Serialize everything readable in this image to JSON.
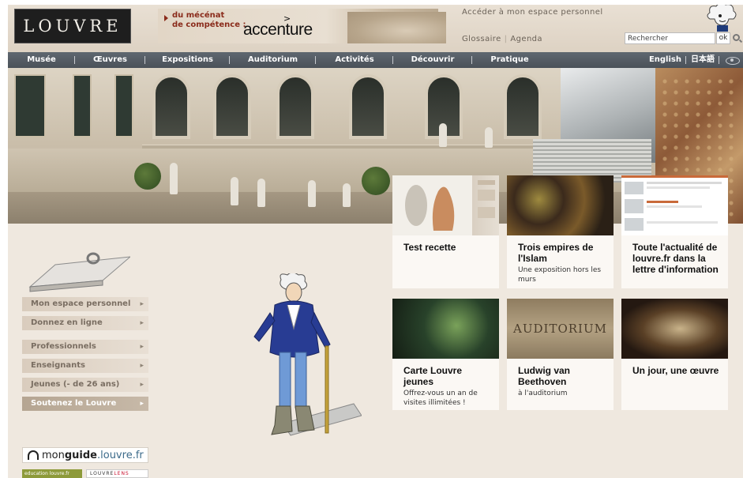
{
  "header": {
    "logo_text": "LOUVRE",
    "sponsor_line1": "du mécénat",
    "sponsor_line2": "de compétence :",
    "sponsor_name": "accenture",
    "espace_link": "Accéder à mon espace personnel",
    "glossaire": "Glossaire",
    "agenda": "Agenda",
    "search_placeholder": "Rechercher",
    "search_button": "ok"
  },
  "nav": {
    "items": [
      "Musée",
      "Œuvres",
      "Expositions",
      "Auditorium",
      "Activités",
      "Découvrir",
      "Pratique"
    ],
    "lang_en": "English",
    "lang_jp": "日本語"
  },
  "sidebar": {
    "menu": [
      {
        "label": "Mon espace personnel"
      },
      {
        "label": "Donnez en ligne"
      },
      {
        "label": "Professionnels"
      },
      {
        "label": "Enseignants"
      },
      {
        "label": "Jeunes (- de 26 ans)"
      },
      {
        "label": "Soutenez le Louvre"
      }
    ],
    "chevron": "▸",
    "monguide_pre": "mon",
    "monguide_bold": "guide",
    "monguide_domain": ".louvre.fr",
    "education_text": "education louvre.fr",
    "lens_pre": "LOUVRE",
    "lens_red": "LENS"
  },
  "cards": [
    {
      "title": "Test recette",
      "subtitle": ""
    },
    {
      "title": "Trois empires de l'Islam",
      "subtitle": "Une exposition hors les murs"
    },
    {
      "title": "Toute l'actualité de louvre.fr dans la lettre d'information",
      "subtitle": ""
    },
    {
      "title": "Carte Louvre jeunes",
      "subtitle": "Offrez-vous un an de visites illimitées !"
    },
    {
      "title": "Ludwig van Beethoven",
      "subtitle": "à l'auditorium",
      "thumb_text": "AUDITORIUM"
    },
    {
      "title": "Un jour, une œuvre",
      "subtitle": ""
    }
  ],
  "colors": {
    "nav_bg": "#4a5159",
    "page_bg": "#efe8df",
    "sponsor_red": "#8a2b1b"
  }
}
